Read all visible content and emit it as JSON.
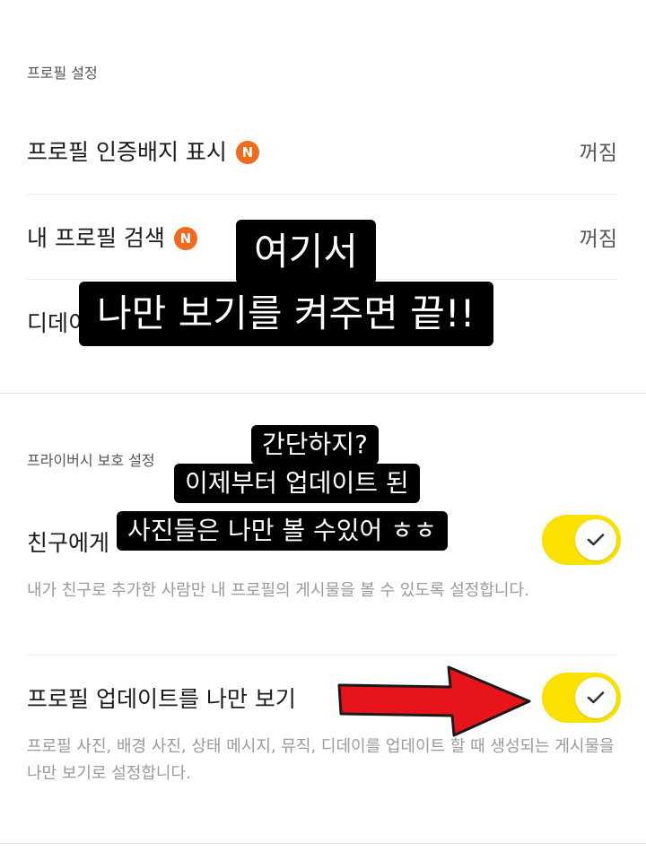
{
  "profile_settings": {
    "header": "프로필 설정",
    "rows": [
      {
        "label": "프로필 인증배지 표시",
        "badge": "N",
        "value": "꺼짐"
      },
      {
        "label": "내 프로필 검색",
        "badge": "N",
        "value": "꺼짐"
      },
      {
        "label": "디데이"
      }
    ]
  },
  "privacy": {
    "header": "프라이버시 보호 설정",
    "friends_only": {
      "label": "친구에게",
      "description": "내가 친구로 추가한 사람만 내 프로필의 게시물을 볼 수 있도록 설정합니다.",
      "enabled": true
    },
    "only_me": {
      "label": "프로필 업데이트를 나만 보기",
      "description": "프로필 사진, 배경 사진, 상태 메시지, 뮤직, 디데이를 업데이트 할 때 생성되는 게시물을 나만 보기로 설정합니다.",
      "enabled": true
    }
  },
  "overlays": {
    "top_line1": "여기서",
    "top_line2": "나만 보기를 켜주면 끝!!",
    "mid_line1": "간단하지?",
    "mid_line2": "이제부터 업데이트 된",
    "mid_line3": "사진들은 나만 볼 수있어 ㅎㅎ"
  },
  "colors": {
    "toggle_on": "#fae100",
    "badge": "#f26a1b",
    "arrow": "#e8141b"
  },
  "icons": {
    "badge": "new-badge-icon",
    "toggle_check": "check-icon",
    "annotation": "red-arrow-icon"
  }
}
